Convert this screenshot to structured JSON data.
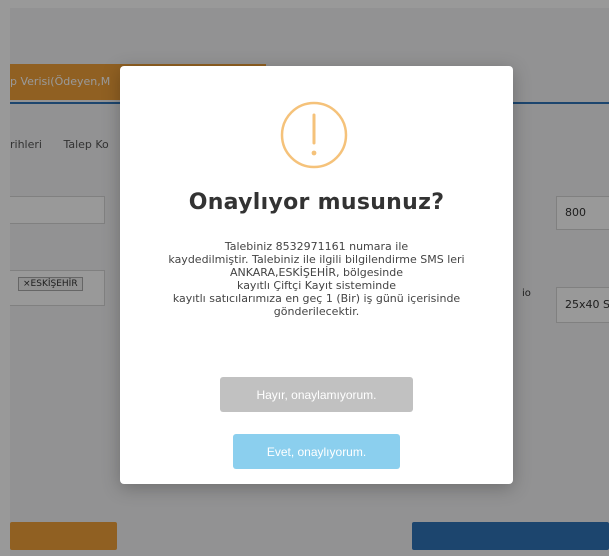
{
  "background": {
    "tab_label": "p Verisi(Ödeyen,M",
    "sub_tabs": [
      "rihleri",
      "Talep Ko"
    ],
    "top_right_value": "800",
    "chip_label": "×ESKİŞEHİR",
    "right_label_fragment": "io",
    "right_value": "25x40 S"
  },
  "modal": {
    "icon": "exclamation-circle-icon",
    "title": "Onaylıyor musunuz?",
    "message_lines": [
      "Talebiniz 8532971161 numara ile",
      "kaydedilmiştir. Talebiniz ile ilgili bilgilendirme SMS leri",
      "ANKARA,ESKİŞEHİR, bölgesinde",
      "kayıtlı Çiftçi Kayıt sisteminde",
      "kayıtlı satıcılarımıza en geç 1 (Bir) iş günü içerisinde",
      "gönderilecektir."
    ],
    "cancel_label": "Hayır, onaylamıyorum.",
    "confirm_label": "Evet, onaylıyorum."
  },
  "colors": {
    "orange": "#f0a13a",
    "blue": "#2f74b8",
    "warning_icon": "#f5c27a",
    "confirm": "#8bcfee",
    "cancel": "#c1c1c1"
  }
}
